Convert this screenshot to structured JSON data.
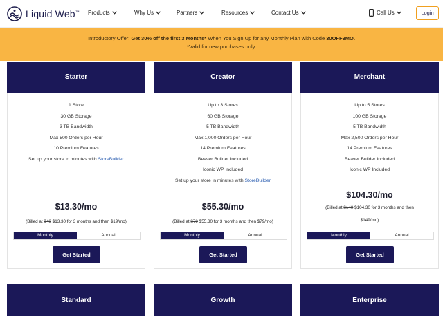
{
  "header": {
    "brand": "Liquid Web",
    "brand_tm": "™",
    "nav": [
      {
        "label": "Products"
      },
      {
        "label": "Why Us"
      },
      {
        "label": "Partners"
      },
      {
        "label": "Resources"
      },
      {
        "label": "Contact Us"
      }
    ],
    "call_us": "Call Us",
    "login": "Login"
  },
  "promo": {
    "lead": "Introductory Offer: ",
    "bold1": "Get 30% off the first 3 Months*",
    "middle": " When You Sign Up for any Monthly Plan with Code ",
    "code": "30OFF3MO.",
    "note": "*Valid for new purchases only."
  },
  "plans": [
    {
      "name": "Starter",
      "features": [
        "1 Store",
        "30 GB Storage",
        "3 TB Bandwidth",
        "Max 500 Orders per Hour",
        "10 Premium Features"
      ],
      "builder_prefix": "Set up your store in minutes with ",
      "builder_link": "StoreBuilder",
      "price": "$13.30/mo",
      "billed_pre": "(Billed at ",
      "billed_strike": "$49",
      "billed_post": " $13.30 for 3 months and then $19/mo)",
      "toggle": [
        "Monthly",
        "Annual"
      ],
      "cta": "Get Started"
    },
    {
      "name": "Creator",
      "features": [
        "Up to 3 Stores",
        "60 GB Storage",
        "5 TB Bandwidth",
        "Max 1,000 Orders per Hour",
        "14 Premium Features",
        "Beaver Builder Included",
        "Iconic WP Included"
      ],
      "builder_prefix": "Set up your store in minutes with ",
      "builder_link": "StoreBuilder",
      "price": "$55.30/mo",
      "billed_pre": "(Billed at ",
      "billed_strike": "$79",
      "billed_post": " $55.30 for 3 months and then $79/mo)",
      "toggle": [
        "Monthly",
        "Annual"
      ],
      "cta": "Get Started"
    },
    {
      "name": "Merchant",
      "features": [
        "Up to 5 Stores",
        "100 GB Storage",
        "5 TB Bandwidth",
        "Max 2,500 Orders per Hour",
        "14 Premium Features",
        "Beaver Builder Included",
        "Iconic WP Included"
      ],
      "price": "$104.30/mo",
      "billed_pre": "(Billed at ",
      "billed_strike": "$149",
      "billed_post": " $104.30 for 3 months and then",
      "billed_line2": "$149/mo)",
      "toggle": [
        "Monthly",
        "Annual"
      ],
      "cta": "Get Started"
    }
  ],
  "lower_plans": [
    "Standard",
    "Growth",
    "Enterprise"
  ],
  "colors": {
    "navy": "#1b1858",
    "promo": "#f9b543",
    "link": "#2a5db0"
  }
}
